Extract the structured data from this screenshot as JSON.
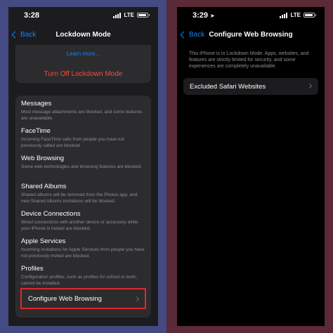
{
  "left": {
    "status": {
      "time": "3:28",
      "network": "LTE"
    },
    "nav": {
      "back_label": "Back",
      "title": "Lockdown Mode"
    },
    "top_card": {
      "learn_more": "Learn more...",
      "turn_off": "Turn Off Lockdown Mode"
    },
    "items": [
      {
        "title": "Messages",
        "desc": "Most message attachments are blocked, and some features are unavailable."
      },
      {
        "title": "FaceTime",
        "desc": "Incoming FaceTime calls from people you have not previously called are blocked."
      },
      {
        "title": "Web Browsing",
        "desc": "Some web technologies and browsing features are blocked."
      },
      {
        "title": "Shared Albums",
        "desc": "Shared albums will be removed from the Photos app, and new Shared Albums invitations will be blocked."
      },
      {
        "title": "Device Connections",
        "desc": "Wired connections with another device or accessory while your iPhone is locked are blocked."
      },
      {
        "title": "Apple Services",
        "desc": "Incoming invitations for Apple Services from people you have not previously invited are blocked."
      },
      {
        "title": "Profiles",
        "desc": "Configuration profiles, such as profiles for school or work, cannot be installed."
      }
    ],
    "configure_label": "Configure Web Browsing"
  },
  "right": {
    "status": {
      "time": "3:29",
      "network": "LTE"
    },
    "nav": {
      "back_label": "Back",
      "title": "Configure Web Browsing"
    },
    "info": "This iPhone is in Lockdown Mode. Apps, websites, and features are strictly limited for security, and some experiences are completely unavailable.",
    "excluded_label": "Excluded Safari Websites"
  },
  "colors": {
    "accent": "#0a84ff",
    "destructive": "#ff453a",
    "highlight_border": "#e2262a",
    "left_background": "#444a82",
    "right_background": "#5a2a36"
  }
}
